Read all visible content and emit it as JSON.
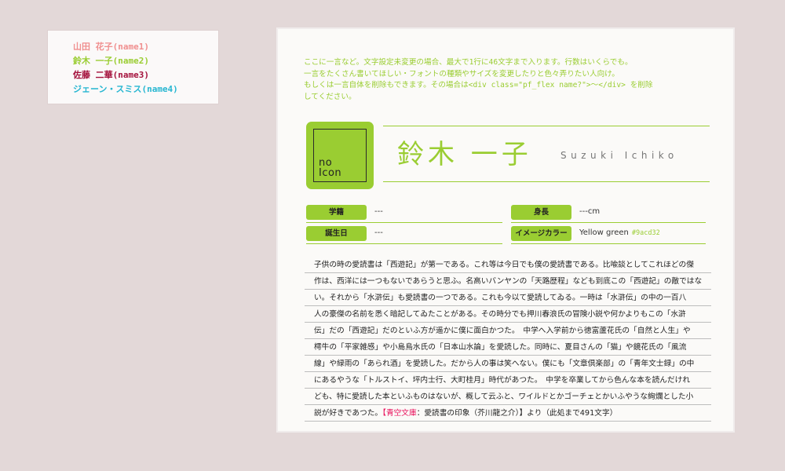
{
  "nav": {
    "items": [
      {
        "label": "山田 花子(name1)",
        "color": "#f08f8f"
      },
      {
        "label": "鈴木 一子(name2)",
        "color": "#9acd32"
      },
      {
        "label": "佐藤 二華(name3)",
        "color": "#a4113c"
      },
      {
        "label": "ジェーン・スミス(name4)",
        "color": "#26b6d1"
      }
    ]
  },
  "profile": {
    "intro_lines": [
      "ここに一言など。文字設定未変更の場合、最大で1行に46文字まで入ります。行数はいくらでも。",
      "一言をたくさん書いてほしい・フォントの種類やサイズを変更したりと色々弄りたい人向け。",
      "もしくは一言自体を削除もできます。その場合は<div class=\"pf_flex name?\">～</div> を削除",
      "してください。"
    ],
    "icon_text_line1": "no",
    "icon_text_line2": "Icon",
    "name_kanji": "鈴木 一子",
    "name_roman": "Suzuki Ichiko",
    "accent_color": "#9acd32",
    "fields": {
      "school": {
        "label": "学籍",
        "value": "---"
      },
      "height": {
        "label": "身長",
        "value": "---cm"
      },
      "birthday": {
        "label": "誕生日",
        "value": "---"
      },
      "image_color": {
        "label": "イメージカラー",
        "value": "Yellow green",
        "code": "#9acd32"
      }
    },
    "body_lines": [
      "子供の時の愛読書は「西遊記」が第一である。これ等は今日でも僕の愛読書である。比喩談としてこれほどの傑",
      "作は、西洋には一つもないであらうと思ふ。名高いバンヤンの「天路歴程」なども到底この「西遊記」の敵ではな",
      "い。それから「水滸伝」も愛読書の一つである。これも今以て愛読してゐる。一時は「水滸伝」の中の一百八",
      "人の豪傑の名前を悉く暗記してゐたことがある。その時分でも押川春浪氏の冒険小説や何かよりもこの「水滸",
      "伝」だの「西遊記」だのといふ方が遥かに僕に面白かつた。　中学へ入学前から徳富蘆花氏の「自然と人生」や",
      "樗牛の「平家雑感」や小島烏水氏の「日本山水論」を愛読した。同時に、夏目さんの「猫」や鏡花氏の「風流",
      "線」や緑雨の「あられ酒」を愛読した。だから人の事は笑へない。僕にも「文章倶楽部」の「青年文士録」の中",
      "にあるやうな「トルストイ、坪内士行、大町桂月」時代があつた。　中学を卒業してから色んな本を読んだけれ",
      "ども、特に愛読した本といふものはないが、概して云ふと、ワイルドとかゴーチェとかいふやうな絢爛とした小"
    ],
    "last_line_prefix": "説が好きであつた。",
    "last_line_bracket_open": "【",
    "last_line_link": "青空文庫",
    "last_line_suffix": "：愛読書の印象（芥川龍之介）】より（此処まで491文字）"
  }
}
